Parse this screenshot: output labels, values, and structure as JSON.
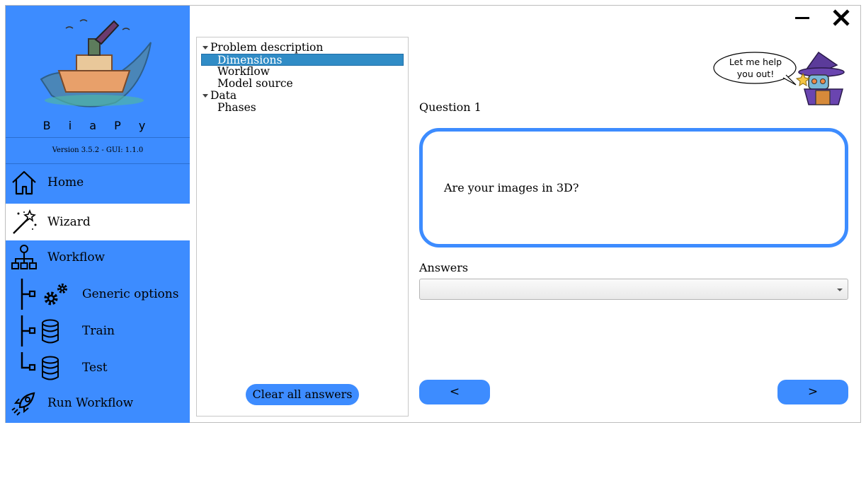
{
  "app": {
    "name": "B i a P y",
    "version": "Version 3.5.2 - GUI: 1.1.0"
  },
  "sidebar": {
    "items": [
      {
        "label": "Home",
        "icon": "home-icon"
      },
      {
        "label": "Wizard",
        "icon": "magic-wand-icon",
        "active": true
      },
      {
        "label": "Workflow",
        "icon": "workflow-icon"
      },
      {
        "label": "Generic options",
        "icon": "gears-icon"
      },
      {
        "label": "Train",
        "icon": "database-icon"
      },
      {
        "label": "Test",
        "icon": "database-icon"
      },
      {
        "label": "Run Workflow",
        "icon": "rocket-icon"
      }
    ]
  },
  "tree": {
    "groups": [
      {
        "label": "Problem description",
        "children": [
          "Dimensions",
          "Workflow",
          "Model source"
        ]
      },
      {
        "label": "Data",
        "children": [
          "Phases"
        ]
      }
    ],
    "selected": "Dimensions",
    "clear_label": "Clear all answers"
  },
  "wizard": {
    "helper_text_line1": "Let me help",
    "helper_text_line2": "you out!",
    "question_title": "Question 1",
    "question_text": "Are your images in 3D?",
    "answers_label": "Answers",
    "answer_value": "",
    "prev_label": "<",
    "next_label": ">"
  },
  "colors": {
    "accent": "#3d8cff",
    "selection": "#308cc6"
  }
}
